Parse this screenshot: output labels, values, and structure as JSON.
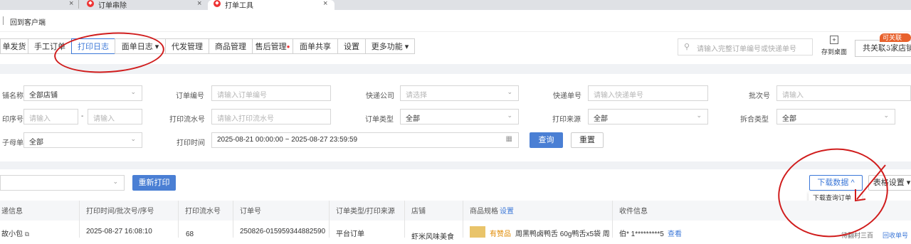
{
  "browser": {
    "tabs": [
      {
        "label": ""
      },
      {
        "label": "订单串除"
      },
      {
        "label": "打单工具"
      }
    ]
  },
  "header": {
    "back_to_client": "回到客户端"
  },
  "nav": {
    "items": [
      "单发货",
      "手工订单",
      "打印日志",
      "面单日志 ▾",
      "代发管理",
      "商品管理",
      "售后管理",
      "面单共享",
      "设置",
      "更多功能 ▾"
    ],
    "search_placeholder": "请输入完整订单编号或快递单号",
    "save_desktop": "存到桌面",
    "share_button": "共关联3家店铺",
    "share_badge": "可关联200"
  },
  "filters": {
    "shop_name": {
      "label": "铺名称",
      "value": "全部店铺"
    },
    "order_no": {
      "label": "订单编号",
      "placeholder": "请输入订单编号"
    },
    "courier": {
      "label": "快递公司",
      "placeholder": "请选择"
    },
    "tracking_no": {
      "label": "快递单号",
      "placeholder": "请输入快递单号"
    },
    "batch_no": {
      "label": "批次号",
      "placeholder": "请输入"
    },
    "seq_no": {
      "label": "印序号",
      "placeholder_from": "请输入",
      "separator": "-",
      "placeholder_to": "请输入"
    },
    "print_serial": {
      "label": "打印流水号",
      "placeholder": "请输入打印流水号"
    },
    "order_type": {
      "label": "订单类型",
      "value": "全部"
    },
    "print_source": {
      "label": "打印来源",
      "value": "全部"
    },
    "split_type": {
      "label": "拆合类型",
      "value": "全部"
    },
    "child_order": {
      "label": "子母单",
      "value": "全部"
    },
    "print_time": {
      "label": "打印时间",
      "value": "2025-08-21 00:00:00 ~ 2025-08-27 23:59:59"
    },
    "query_button": "查询",
    "reset_button": "重置"
  },
  "toolbar": {
    "reprint_button": "重新打印",
    "download_button": "下载数据 ^",
    "download_menu_item": "下载查询订单",
    "table_settings": "表格设置 ▾"
  },
  "table": {
    "headers": [
      "递信息",
      "打印时间/批次号/序号",
      "打印流水号",
      "订单号",
      "订单类型/打印来源",
      "店铺",
      "商品规格",
      "设置",
      "收件信息"
    ],
    "row": {
      "package": "故小包",
      "print_time": "2025-08-27 16:08:10",
      "serial": "68",
      "order_no": "250826-015959344882590",
      "order_type": "平台订单",
      "shop": "虾米风味美食",
      "product_tag": "有赞品",
      "product": "周黑鸭卤鸭舌 60g鸭舌x5袋 周",
      "receiver": "伯* 1*********5",
      "view_link": "查看",
      "right_action_1": "待翻村三百",
      "right_action_2": "回收单号"
    }
  },
  "colors": {
    "accent": "#4a7fd4",
    "annotation": "#d01c1c",
    "badge": "#e8612c"
  }
}
